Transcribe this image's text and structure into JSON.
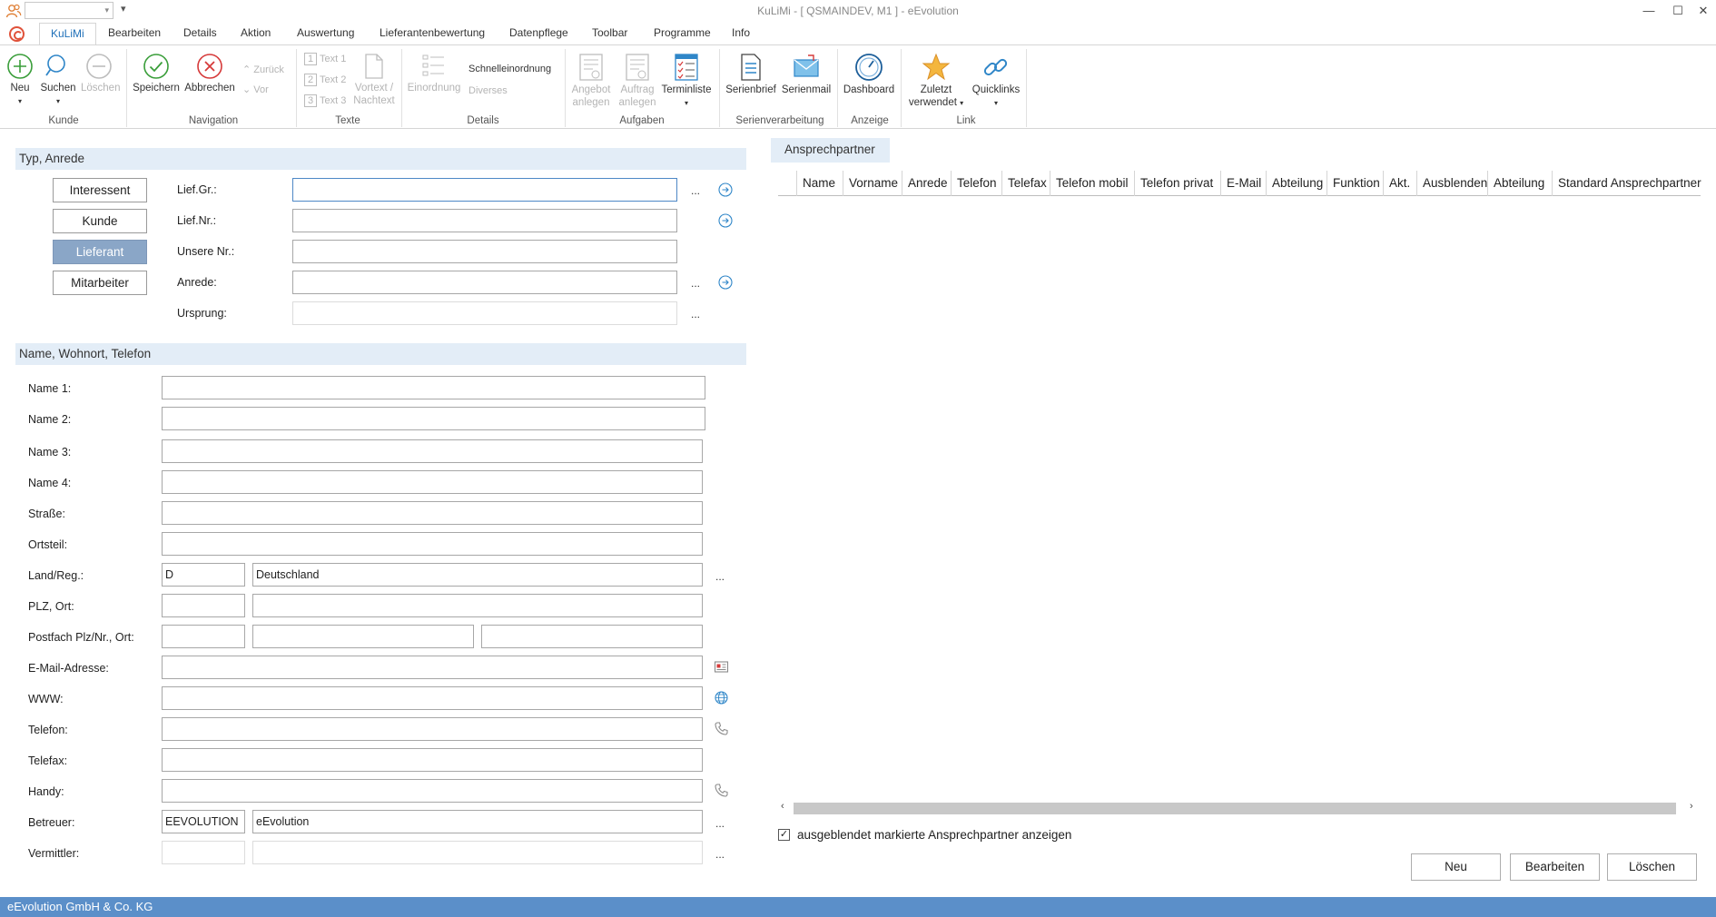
{
  "titlebar": {
    "title": "KuLiMi - [ QSMAINDEV, M1 ]  -  eEvolution",
    "user_icon": "user-icon",
    "minimize": "—",
    "maximize": "☐",
    "close": "✕"
  },
  "menu": {
    "tabs": [
      {
        "label": "KuLiMi"
      },
      {
        "label": "Bearbeiten"
      },
      {
        "label": "Details"
      },
      {
        "label": "Aktion"
      },
      {
        "label": "Auswertung"
      },
      {
        "label": "Lieferantenbewertung"
      },
      {
        "label": "Datenpflege"
      },
      {
        "label": "Toolbar"
      },
      {
        "label": "Programme"
      },
      {
        "label": "Info"
      }
    ]
  },
  "ribbon": {
    "kunde": {
      "label": "Kunde",
      "neu": "Neu",
      "suchen": "Suchen",
      "loeschen": "Löschen"
    },
    "navigation": {
      "label": "Navigation",
      "speichern": "Speichern",
      "abbrechen": "Abbrechen",
      "zurueck": "Zurück",
      "vor": "Vor"
    },
    "texte": {
      "label": "Texte",
      "text1": "Text 1",
      "text2": "Text 2",
      "text3": "Text 3",
      "vortext_1": "Vortext /",
      "vortext_2": "Nachtext"
    },
    "details": {
      "label": "Details",
      "einordnung": "Einordnung",
      "schnelleinordnung": "Schnelleinordnung",
      "diverses": "Diverses"
    },
    "aufgaben": {
      "label": "Aufgaben",
      "angebot_1": "Angebot",
      "angebot_2": "anlegen",
      "auftrag_1": "Auftrag",
      "auftrag_2": "anlegen",
      "terminliste": "Terminliste"
    },
    "serienverarbeitung": {
      "label": "Serienverarbeitung",
      "serienbrief": "Serienbrief",
      "serienmail": "Serienmail"
    },
    "anzeige": {
      "label": "Anzeige",
      "dashboard": "Dashboard"
    },
    "link": {
      "label": "Link",
      "zuletzt_1": "Zuletzt",
      "zuletzt_2": "verwendet",
      "quicklinks": "Quicklinks"
    }
  },
  "typ_anrede": {
    "header": "Typ, Anrede",
    "types": [
      "Interessent",
      "Kunde",
      "Lieferant",
      "Mitarbeiter"
    ],
    "selected": "Lieferant",
    "labels": {
      "lief_gr": "Lief.Gr.:",
      "lief_nr": "Lief.Nr.:",
      "unsere_nr": "Unsere Nr.:",
      "anrede": "Anrede:",
      "ursprung": "Ursprung:"
    },
    "dots": "..."
  },
  "name_section": {
    "header": "Name, Wohnort, Telefon",
    "labels": {
      "name1": "Name 1:",
      "name2": "Name 2:",
      "name3": "Name 3:",
      "name4": "Name 4:",
      "strasse": "Straße:",
      "ortsteil": "Ortsteil:",
      "land": "Land/Reg.:",
      "plz": "PLZ, Ort:",
      "postfach": "Postfach Plz/Nr., Ort:",
      "email": "E-Mail-Adresse:",
      "www": "WWW:",
      "telefon": "Telefon:",
      "telefax": "Telefax:",
      "handy": "Handy:",
      "betreuer": "Betreuer:",
      "vermittler": "Vermittler:"
    },
    "values": {
      "land_code": "D",
      "land_name": "Deutschland",
      "betreuer_code": "EEVOLUTION",
      "betreuer_name": "eEvolution"
    }
  },
  "ansprechpartner": {
    "tab": "Ansprechpartner",
    "columns": [
      "Name",
      "Vorname",
      "Anrede",
      "Telefon",
      "Telefax",
      "Telefon mobil",
      "Telefon privat",
      "E-Mail",
      "Abteilung",
      "Funktion",
      "Akt.",
      "Ausblenden",
      "Abteilung",
      "Standard Ansprechpartner"
    ],
    "show_hidden_label": "ausgeblendet markierte Ansprechpartner anzeigen",
    "show_hidden_checked": "✓",
    "buttons": {
      "neu": "Neu",
      "bearbeiten": "Bearbeiten",
      "loeschen": "Löschen"
    },
    "scroll_left": "‹",
    "scroll_right": "›"
  },
  "statusbar": {
    "text": "eEvolution GmbH & Co. KG"
  },
  "colors": {
    "accent": "#5b8fc9",
    "section": "#e3edf7",
    "selected_type": "#8aa6c7"
  }
}
